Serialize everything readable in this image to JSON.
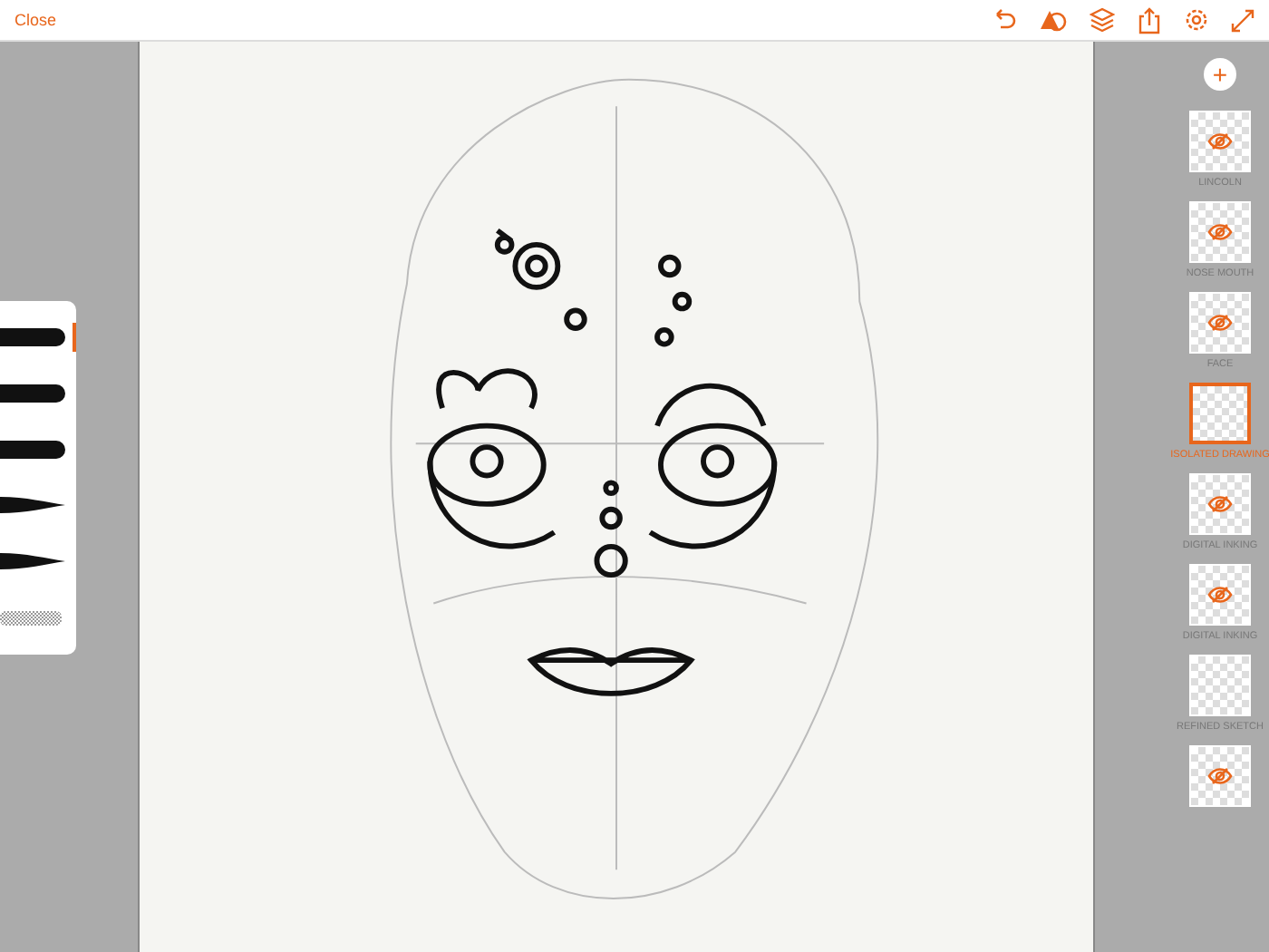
{
  "toolbar": {
    "close": "Close"
  },
  "brushes": [
    {
      "kind": "round",
      "selected": true
    },
    {
      "kind": "round",
      "selected": false
    },
    {
      "kind": "round",
      "selected": false
    },
    {
      "kind": "taper",
      "selected": false
    },
    {
      "kind": "taper",
      "selected": false
    },
    {
      "kind": "texture",
      "selected": false
    }
  ],
  "add_layer": "+",
  "layers": [
    {
      "name": "LINCOLN",
      "selected": false,
      "hidden": true
    },
    {
      "name": "NOSE MOUTH",
      "selected": false,
      "hidden": true
    },
    {
      "name": "FACE",
      "selected": false,
      "hidden": true
    },
    {
      "name": "ISOLATED DRAWING",
      "selected": true,
      "hidden": false
    },
    {
      "name": "DIGITAL INKING",
      "selected": false,
      "hidden": true
    },
    {
      "name": "DIGITAL INKING",
      "selected": false,
      "hidden": true
    },
    {
      "name": "REFINED SKETCH",
      "selected": false,
      "hidden": false
    },
    {
      "selected": false,
      "hidden": true
    }
  ]
}
